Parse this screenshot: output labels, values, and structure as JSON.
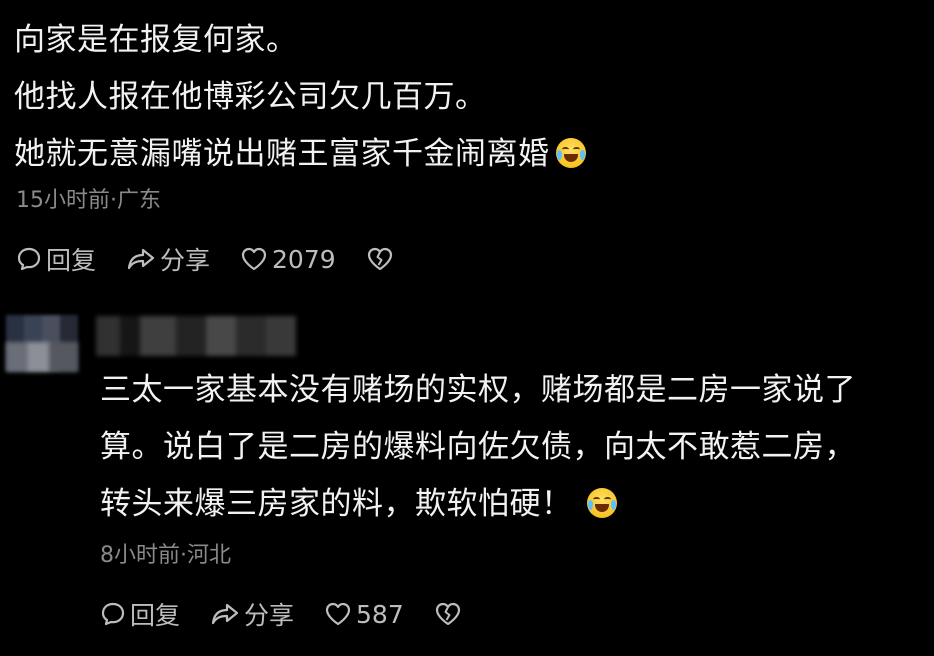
{
  "comments": [
    {
      "lines": [
        "向家是在报复何家。",
        "他找人报在他博彩公司欠几百万。",
        "她就无意漏嘴说出赌王富家千金闹离婚"
      ],
      "emoji": "crying-laughing-emoji",
      "meta": "15小时前·广东",
      "reply_label": "回复",
      "share_label": "分享",
      "like_count": "2079"
    },
    {
      "username": "",
      "lines": [
        "三太一家基本没有赌场的实权，赌场都是二房一家说了",
        "算。说白了是二房的爆料向佐欠债，向太不敢惹二房，",
        "转头来爆三房家的料，欺软怕硬！"
      ],
      "emoji": "crying-laughing-emoji",
      "meta": "8小时前·河北",
      "reply_label": "回复",
      "share_label": "分享",
      "like_count": "587"
    }
  ],
  "icons": {
    "reply": "reply-bubble-icon",
    "share": "share-arrow-icon",
    "like": "heart-icon",
    "dislike": "broken-heart-icon"
  },
  "colors": {
    "background": "#000000",
    "text": "#f2f2f2",
    "meta": "#8a8a8a",
    "actions": "#bdbdbd"
  }
}
